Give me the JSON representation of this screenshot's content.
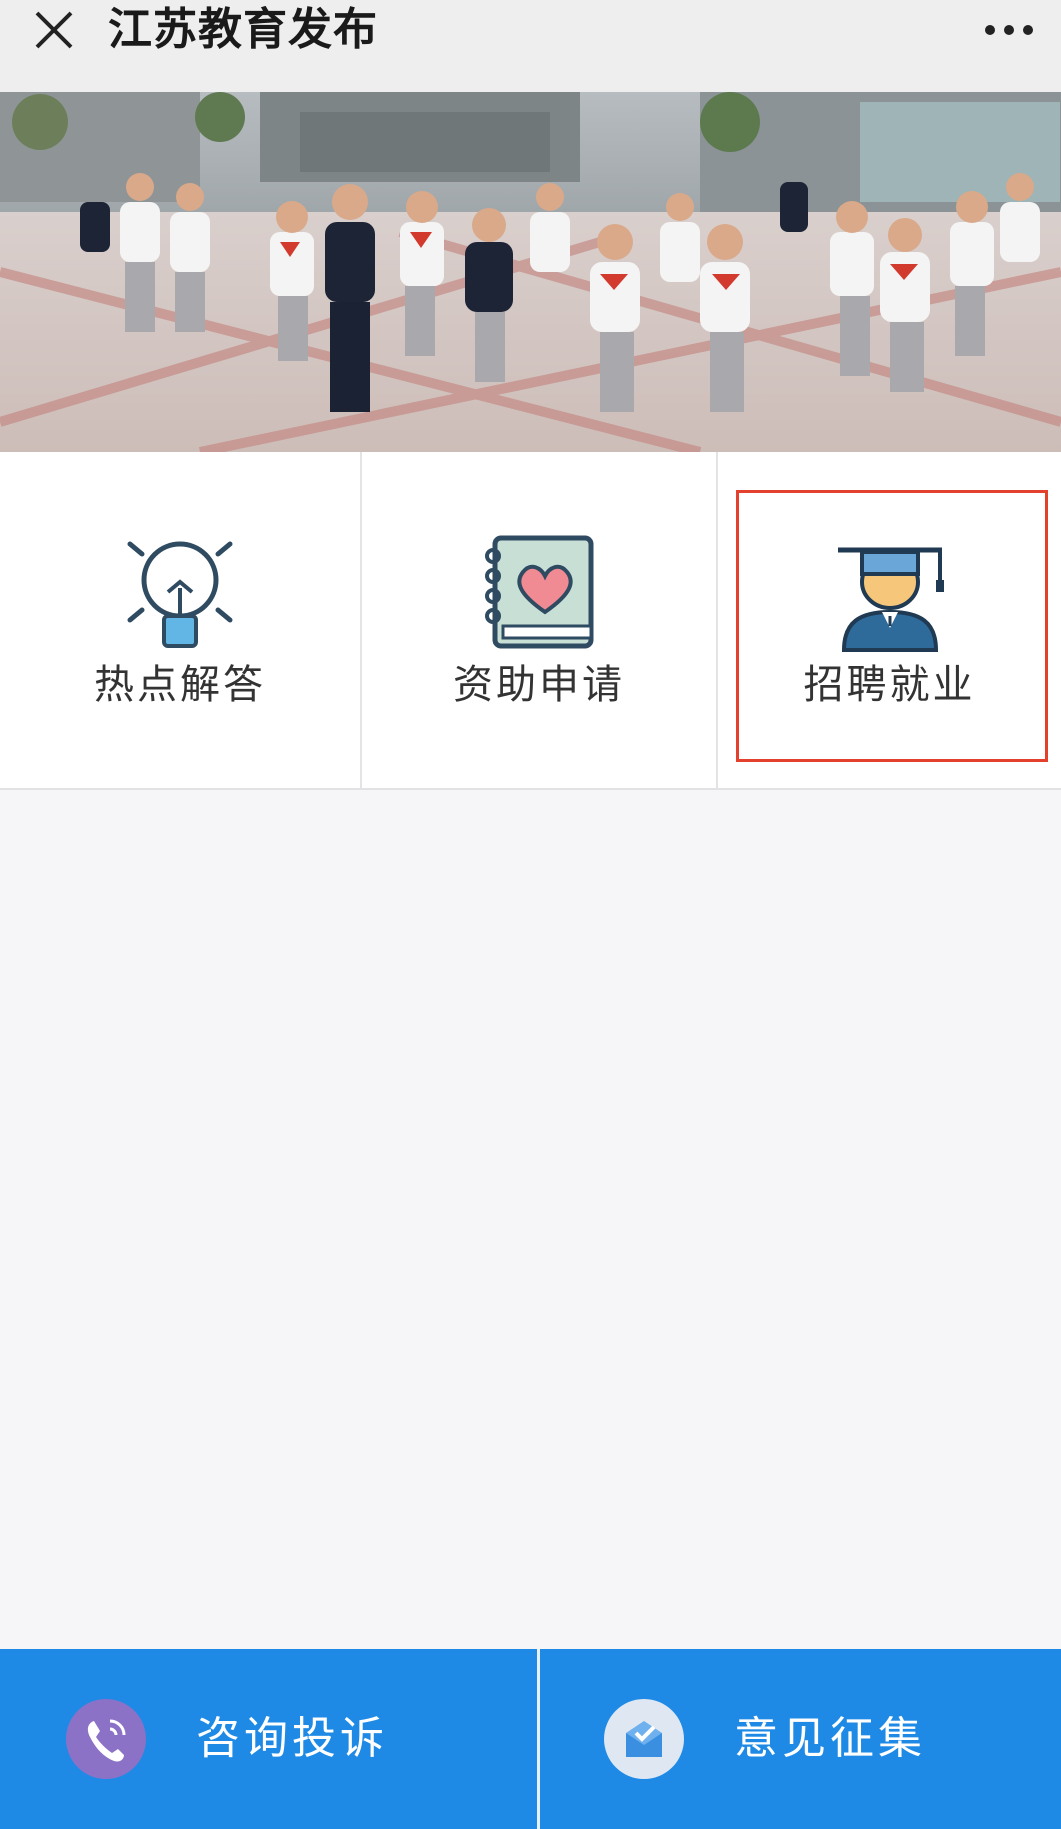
{
  "header": {
    "title": "江苏教育发布",
    "close_icon": "close-icon",
    "more_icon": "more-dots-icon"
  },
  "banner": {
    "description_icon": "photo-students-running"
  },
  "grid": {
    "items": [
      {
        "label": "热点解答",
        "icon": "lightbulb-icon"
      },
      {
        "label": "资助申请",
        "icon": "heart-book-icon"
      },
      {
        "label": "招聘就业",
        "icon": "graduate-icon"
      }
    ]
  },
  "bottom": {
    "left": {
      "label": "咨询投诉",
      "icon": "phone-icon"
    },
    "right": {
      "label": "意见征集",
      "icon": "mail-check-icon"
    }
  },
  "colors": {
    "accent": "#1e8ae6",
    "highlight": "#e3412e",
    "phone_circle": "#8b72c6",
    "mail_circle": "#dfe7f2"
  }
}
